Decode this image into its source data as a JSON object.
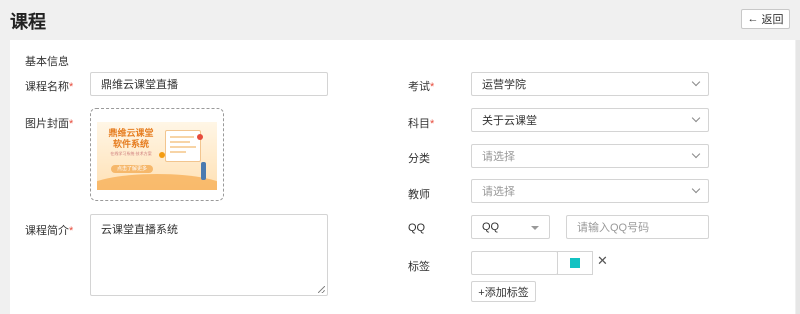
{
  "page": {
    "title": "课程",
    "back_label": "返回"
  },
  "section": {
    "title": "基本信息"
  },
  "form": {
    "course_name": {
      "label": "课程名称",
      "required": "*",
      "value": "鼎维云课堂直播"
    },
    "cover": {
      "label": "图片封面",
      "required": "*",
      "image_title": "鼎维云课堂 软件系统",
      "image_subtitle": "在线学习系统·技术方案",
      "image_cta": "点击了解更多"
    },
    "intro": {
      "label": "课程简介",
      "required": "*",
      "value": "云课堂直播系统"
    },
    "exam": {
      "label": "考试",
      "required": "*",
      "value": "运营学院"
    },
    "subject": {
      "label": "科目",
      "required": "*",
      "value": "关于云课堂"
    },
    "category": {
      "label": "分类",
      "placeholder": "请选择"
    },
    "teacher": {
      "label": "教师",
      "placeholder": "请选择"
    },
    "qq": {
      "label": "QQ",
      "type_value": "QQ",
      "placeholder": "请输入QQ号码"
    },
    "tags": {
      "label": "标签",
      "tag_value": "",
      "swatch_color": "#13c2c2",
      "add_label": "+添加标签"
    }
  },
  "icons": {
    "back": "arrow-left-icon",
    "remove": "close-icon"
  }
}
